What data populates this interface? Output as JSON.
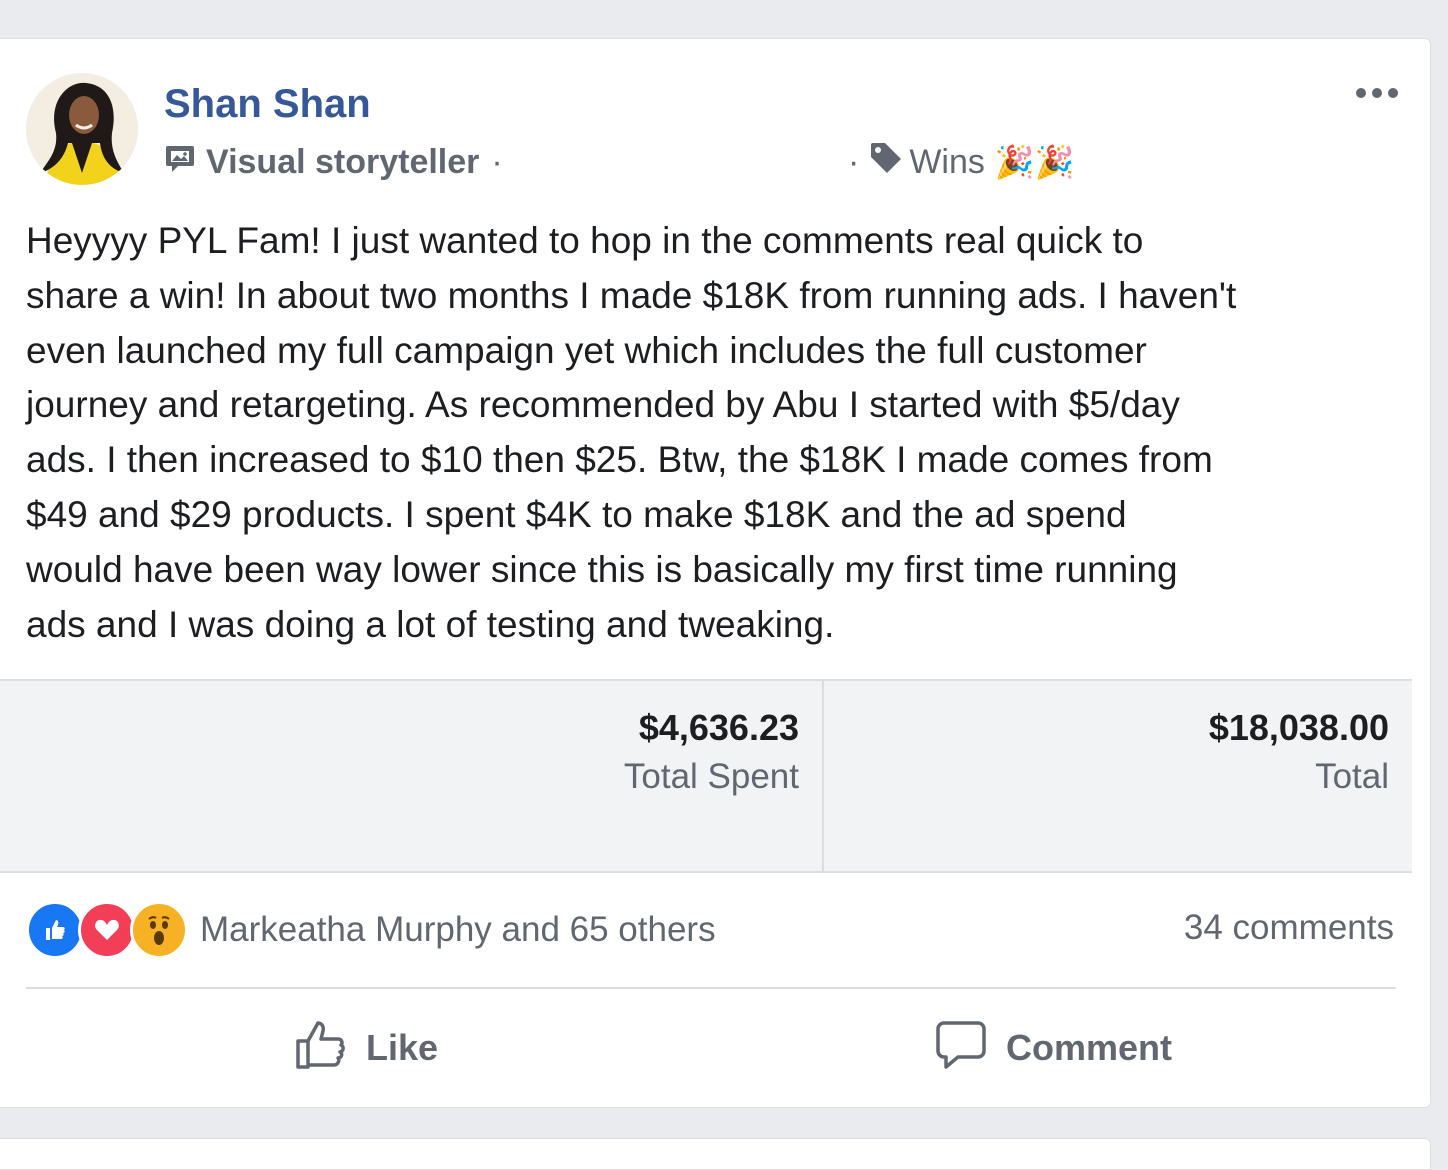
{
  "post": {
    "author": "Shan Shan",
    "author_badge": "Visual storyteller",
    "badge_separator": "·",
    "topic_separator": "·",
    "topic": "Wins",
    "topic_emoji": "🎉🎉",
    "more_icon": "more-options-icon",
    "body_lines": [
      "Heyyyy PYL Fam! I just wanted to hop in the comments real quick to",
      "share a win! In about two months I made $18K from running ads. I haven't",
      "even launched my full campaign yet which includes the full customer",
      "journey and retargeting. As recommended by Abu I started with $5/day",
      "ads. I then increased to $10 then $25. Btw, the $18K I made comes from",
      "$49 and $29 products. I spent $4K to make $18K and the ad spend",
      "would have been way lower since this is basically my first time running",
      "ads and I was doing a lot of testing and tweaking."
    ]
  },
  "stats": [
    {
      "value": "$4,636.23",
      "label": "Total Spent"
    },
    {
      "value": "$18,038.00",
      "label": "Total"
    }
  ],
  "reactions": {
    "icons": [
      "like-reaction-icon",
      "love-reaction-icon",
      "wow-reaction-icon"
    ],
    "summary": "Markeatha Murphy and 65 others",
    "comments": "34 comments"
  },
  "actions": {
    "like": "Like",
    "comment": "Comment"
  },
  "colors": {
    "link_blue": "#365899",
    "like_blue": "#1877f2",
    "love_red": "#f33e58",
    "wow_yellow": "#f7b125",
    "secondary_text": "#606770"
  }
}
